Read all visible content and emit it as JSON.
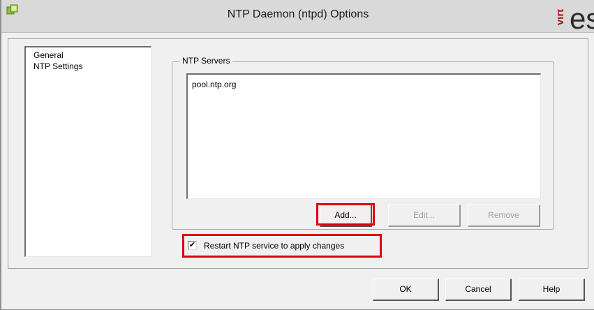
{
  "window": {
    "title": "NTP Daemon (ntpd) Options",
    "watermark_rotated": "virt",
    "watermark_text": "es"
  },
  "nav": {
    "items": [
      {
        "label": "General"
      },
      {
        "label": "NTP Settings"
      }
    ]
  },
  "ntp_servers": {
    "group_label": "NTP Servers",
    "servers": [
      "pool.ntp.org"
    ],
    "add_label": "Add...",
    "edit_label": "Edit...",
    "remove_label": "Remove"
  },
  "restart_option": {
    "label": "Restart NTP service to apply changes",
    "checked": true,
    "check_glyph": "✔"
  },
  "footer": {
    "ok_label": "OK",
    "cancel_label": "Cancel",
    "help_label": "Help"
  },
  "colors": {
    "highlight": "#e00010",
    "watermark_red": "#b5121b"
  }
}
